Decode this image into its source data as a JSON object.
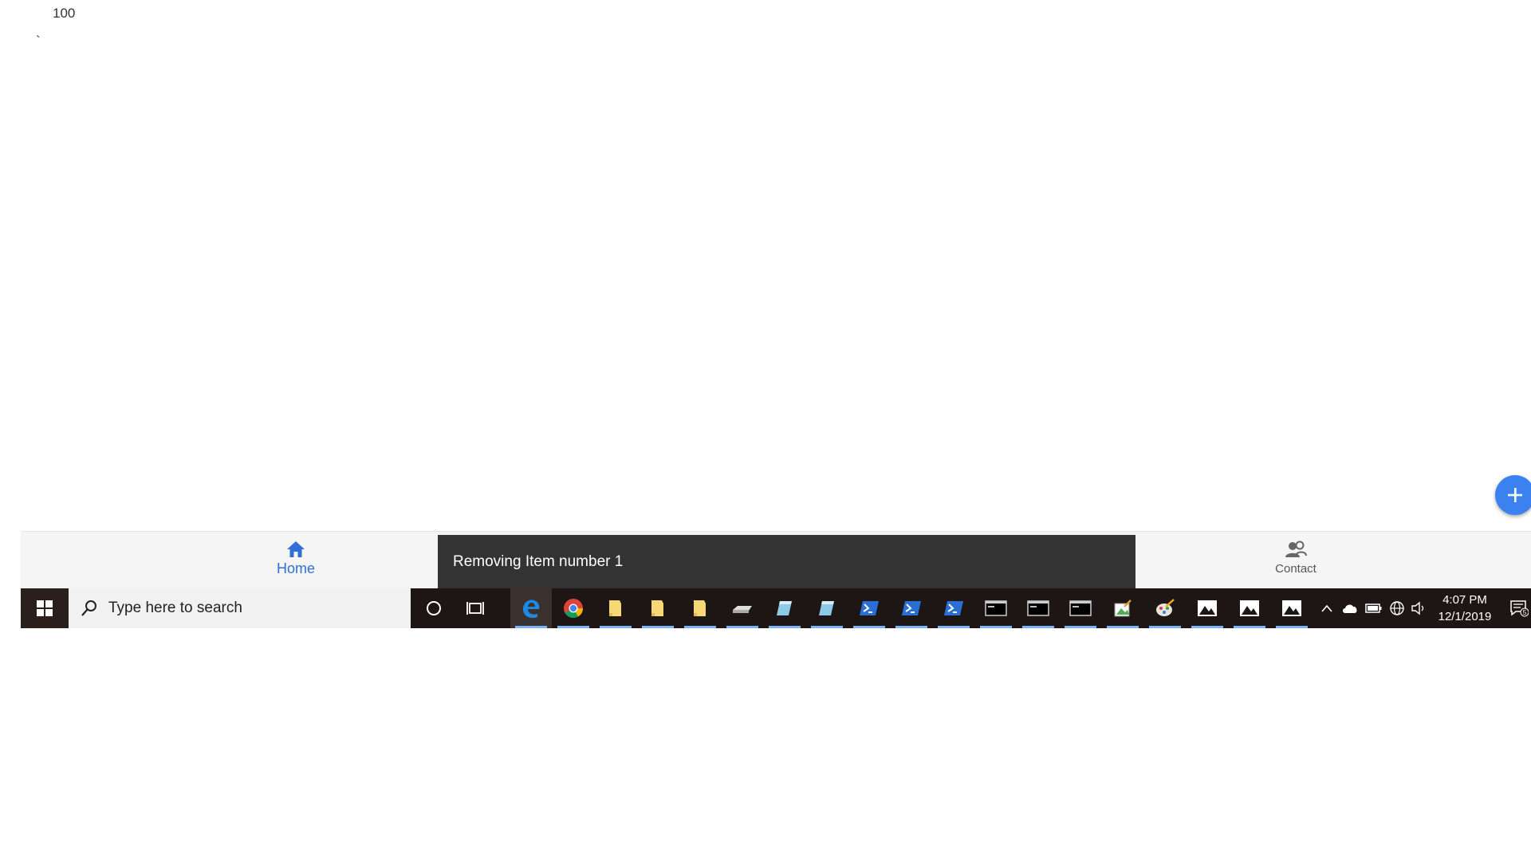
{
  "page": {
    "count_text": "100",
    "stray_char": "`"
  },
  "fab": {
    "label": "+"
  },
  "bottom_nav": {
    "home_label": "Home",
    "contact_label": "Contact",
    "home_color": "#2f6fd6"
  },
  "snackbar": {
    "message": "Removing Item number 1"
  },
  "taskbar": {
    "search_placeholder": "Type here to search",
    "apps": [
      "edge-icon",
      "chrome-icon",
      "file-explorer-icon",
      "file-explorer-icon",
      "file-explorer-icon",
      "drive-icon",
      "notepad-icon",
      "notepad-icon",
      "powershell-icon",
      "powershell-icon",
      "powershell-icon",
      "cmd-icon",
      "cmd-icon",
      "cmd-icon",
      "paint-icon",
      "paint3d-icon",
      "photos-icon",
      "photos-icon",
      "photos-icon"
    ],
    "time": "4:07 PM",
    "date": "12/1/2019",
    "notification_count": "5",
    "accent": "#7ab3f5"
  }
}
